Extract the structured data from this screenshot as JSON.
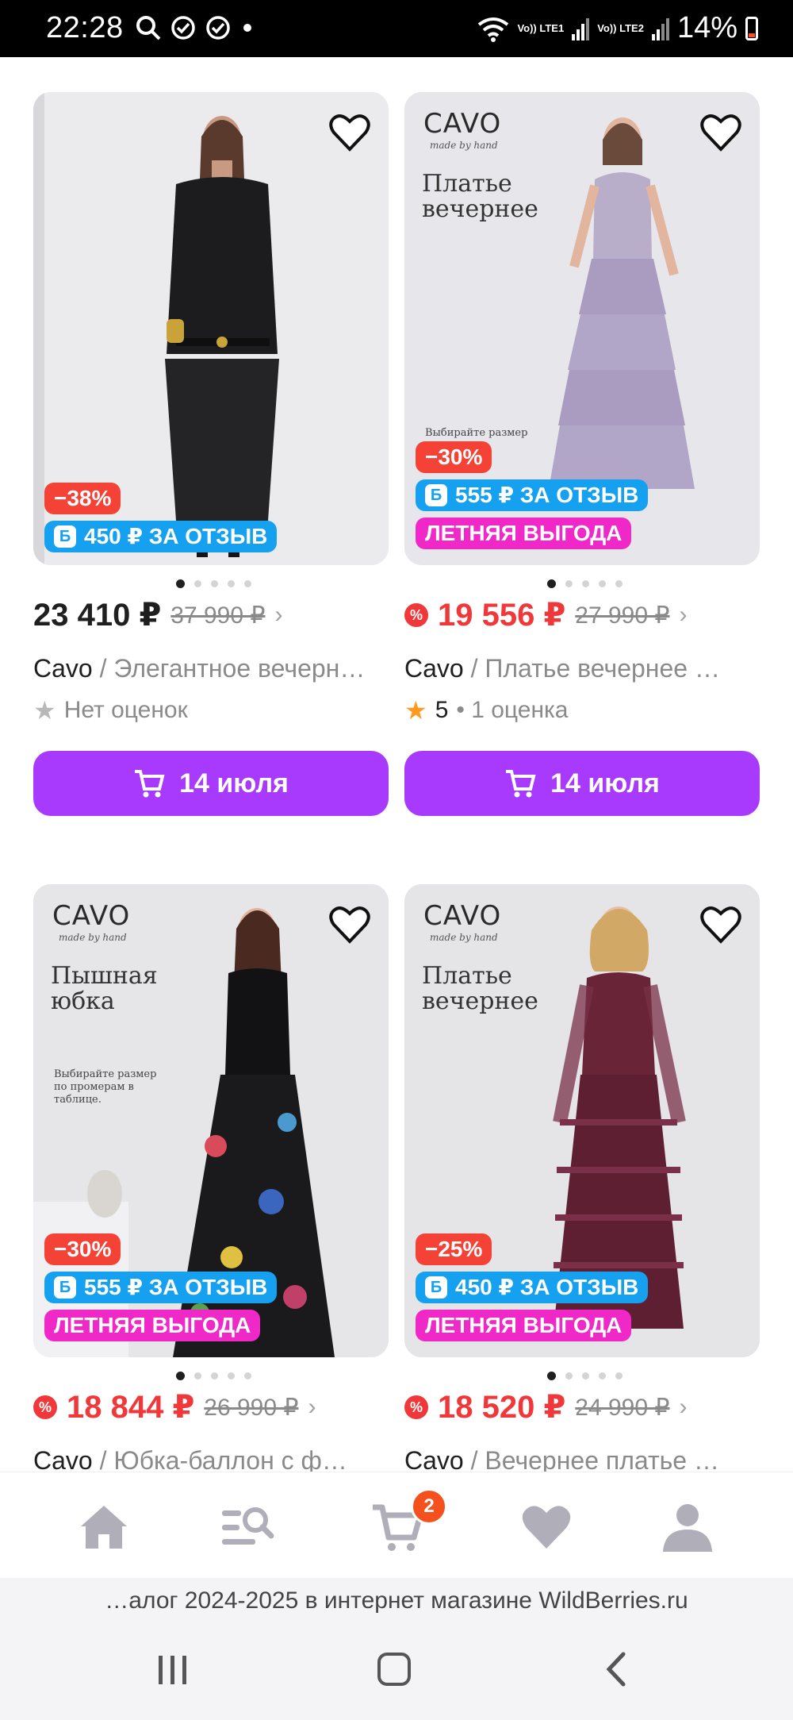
{
  "status_bar": {
    "time": "22:28",
    "sim1": "Vo)) LTE1",
    "sim2": "Vo)) LTE2",
    "battery": "14%"
  },
  "products": [
    {
      "discount": "−38%",
      "review_bonus": "450 ₽ ЗА ОТЗЫВ",
      "review_icon": "Б",
      "summer_badge": "",
      "price": "23 410 ₽",
      "old_price": "37 990 ₽",
      "brand": "Cavo",
      "title": " / Элегантное вечерн…",
      "rating_value": "",
      "rating_text": "Нет оценок",
      "delivery": "14 июля",
      "image_text": {}
    },
    {
      "discount": "−30%",
      "review_bonus": "555 ₽ ЗА ОТЗЫВ",
      "review_icon": "Б",
      "summer_badge": "ЛЕТНЯЯ ВЫГОДА",
      "price": "19 556 ₽",
      "old_price": "27 990 ₽",
      "brand": "Cavo",
      "title": " / Платье вечернее …",
      "rating_value": "5",
      "rating_text": "• 1 оценка",
      "delivery": "14 июля",
      "image_text": {
        "logo": "CAVO",
        "logo_sub": "made by hand",
        "headline": "Платье вечернее",
        "note": "Выбирайте размер"
      }
    },
    {
      "discount": "−30%",
      "review_bonus": "555 ₽ ЗА ОТЗЫВ",
      "review_icon": "Б",
      "summer_badge": "ЛЕТНЯЯ ВЫГОДА",
      "price": "18 844 ₽",
      "old_price": "26 990 ₽",
      "brand": "Cavo",
      "title": " / Юбка-баллон с ф…",
      "image_text": {
        "logo": "CAVO",
        "logo_sub": "made by hand",
        "headline": "Пышная юбка",
        "note": "Выбирайте размер по промерам в таблице."
      }
    },
    {
      "discount": "−25%",
      "review_bonus": "450 ₽ ЗА ОТЗЫВ",
      "review_icon": "Б",
      "summer_badge": "ЛЕТНЯЯ ВЫГОДА",
      "price": "18 520 ₽",
      "old_price": "24 990 ₽",
      "brand": "Cavo",
      "title": " / Вечернее платье …",
      "image_text": {
        "logo": "CAVO",
        "logo_sub": "made by hand",
        "headline": "Платье вечернее",
        "note": ""
      }
    }
  ],
  "bottom_nav": {
    "items": [
      "home-icon",
      "catalog-search-icon",
      "cart-icon",
      "favorites-icon",
      "profile-icon"
    ],
    "cart_count": "2"
  },
  "address_bar": {
    "text": "…алог 2024-2025 в интернет магазине WildBerries.ru"
  },
  "colors": {
    "accent": "#a73afd",
    "price_red": "#f0383a",
    "discount_badge": "#f44336",
    "review_badge": "#16a1f0",
    "summer_badge": "#f028c8"
  }
}
